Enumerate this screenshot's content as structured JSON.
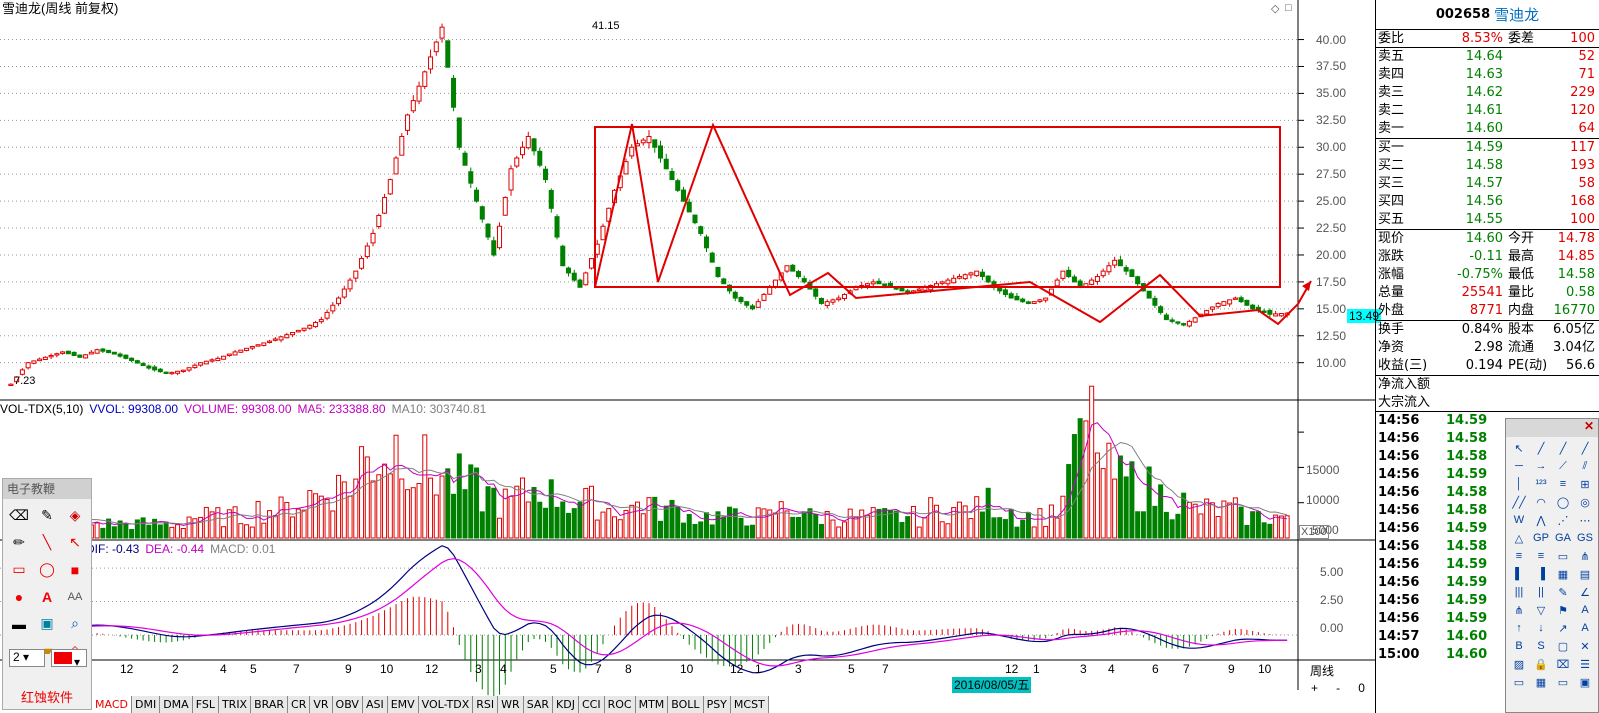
{
  "title": "雪迪龙(周线 前复权)",
  "window_controls": [
    "◇",
    "□"
  ],
  "price_axis": [
    "40.00",
    "37.50",
    "35.00",
    "32.50",
    "30.00",
    "27.50",
    "25.00",
    "22.50",
    "20.00",
    "17.50",
    "15.00",
    "12.50",
    "10.00"
  ],
  "high_label": "41.15",
  "low_label": "7.23",
  "current_price_box": "13.49",
  "vol_header": {
    "name": "VOL-TDX(5,10)",
    "vvol": "VVOL: 99308.00",
    "volume": "VOLUME: 99308.00",
    "ma5": "MA5: 233388.80",
    "ma10": "MA10: 303740.81"
  },
  "vol_axis": [
    "15000",
    "10000",
    "5000"
  ],
  "vol_unit": "X100",
  "macd_header": {
    "name": "MACD",
    "dif": "DIF: -0.43",
    "dea": "DEA: -0.44",
    "macd": "MACD: 0.01"
  },
  "macd_axis": [
    "5.00",
    "2.50",
    "0.00"
  ],
  "x_axis_labels": [
    "12",
    "2",
    "4",
    "5",
    "7",
    "9",
    "10",
    "12",
    "3",
    "4",
    "5",
    "7",
    "8",
    "10",
    "12",
    "1",
    "3",
    "5",
    "7",
    "2016/08/05/五",
    "12",
    "1",
    "3",
    "4",
    "6",
    "7",
    "9",
    "10"
  ],
  "period_label": "周线",
  "nav_controls": [
    "+",
    "-",
    "0"
  ],
  "tabs": [
    "MACD",
    "DMI",
    "DMA",
    "FSL",
    "TRIX",
    "BRAR",
    "CR",
    "VR",
    "OBV",
    "ASI",
    "EMV",
    "VOL-TDX",
    "RSI",
    "WR",
    "SAR",
    "KDJ",
    "CCI",
    "ROC",
    "MTM",
    "BOLL",
    "PSY",
    "MCST"
  ],
  "tools_window": {
    "title": "电子教鞭",
    "line_width": "2",
    "footer": "红蚀软件"
  },
  "quote": {
    "code": "002658",
    "name": "雪迪龙",
    "weibi_label": "委比",
    "weibi": "8.53%",
    "weicha_label": "委差",
    "weicha": "100",
    "sell": [
      [
        "卖五",
        "14.64",
        "52"
      ],
      [
        "卖四",
        "14.63",
        "71"
      ],
      [
        "卖三",
        "14.62",
        "229"
      ],
      [
        "卖二",
        "14.61",
        "120"
      ],
      [
        "卖一",
        "14.60",
        "64"
      ]
    ],
    "buy": [
      [
        "买一",
        "14.59",
        "117"
      ],
      [
        "买二",
        "14.58",
        "193"
      ],
      [
        "买三",
        "14.57",
        "58"
      ],
      [
        "买四",
        "14.56",
        "168"
      ],
      [
        "买五",
        "14.55",
        "100"
      ]
    ],
    "stats": [
      [
        "现价",
        "14.60",
        "今开",
        "14.78"
      ],
      [
        "涨跌",
        "-0.11",
        "最高",
        "14.85"
      ],
      [
        "涨幅",
        "-0.75%",
        "最低",
        "14.58"
      ],
      [
        "总量",
        "25541",
        "量比",
        "0.58"
      ],
      [
        "外盘",
        "8771",
        "内盘",
        "16770"
      ]
    ],
    "stats2": [
      [
        "换手",
        "0.84%",
        "股本",
        "6.05亿"
      ],
      [
        "净资",
        "2.98",
        "流通",
        "3.04亿"
      ],
      [
        "收益(三)",
        "0.194",
        "PE(动)",
        "56.6"
      ]
    ],
    "flow": [
      "净流入额",
      "大宗流入"
    ],
    "ticks": [
      [
        "14:56",
        "14.59"
      ],
      [
        "14:56",
        "14.58"
      ],
      [
        "14:56",
        "14.58"
      ],
      [
        "14:56",
        "14.59"
      ],
      [
        "14:56",
        "14.58"
      ],
      [
        "14:56",
        "14.58"
      ],
      [
        "14:56",
        "14.59"
      ],
      [
        "14:56",
        "14.58"
      ],
      [
        "14:56",
        "14.59"
      ],
      [
        "14:56",
        "14.59"
      ],
      [
        "14:56",
        "14.59"
      ],
      [
        "14:56",
        "14.59"
      ],
      [
        "14:57",
        "14.60"
      ],
      [
        "15:00",
        "14.60"
      ]
    ]
  },
  "chart_data": {
    "type": "candlestick",
    "title": "雪迪龙(周线 前复权)",
    "y_range": [
      7,
      42
    ],
    "price_path": [
      8,
      10,
      10.5,
      11,
      10.5,
      11.2,
      10.8,
      10.2,
      9.5,
      9.0,
      9.3,
      10,
      10.4,
      11,
      11.5,
      12,
      12.6,
      13.2,
      14,
      16,
      18.5,
      22,
      27,
      33,
      37,
      41.15,
      30,
      25,
      20,
      28,
      31,
      27,
      19,
      17,
      21,
      26,
      30,
      31,
      28,
      25,
      22,
      18,
      16,
      15,
      17,
      19,
      17.5,
      15.5,
      16,
      17,
      17.5,
      17,
      16.5,
      17,
      17.5,
      18,
      18.5,
      17,
      16,
      15.5,
      16,
      18.5,
      17,
      18,
      19.5,
      18,
      16,
      14,
      13.5,
      14.5,
      15.5,
      16,
      15,
      14.5,
      14.6
    ],
    "volume_path": [
      3,
      2,
      3,
      2,
      2,
      2,
      2,
      2,
      2,
      2,
      3,
      3,
      3,
      3,
      4,
      4,
      5,
      6,
      7,
      8,
      11,
      12,
      13,
      10,
      9,
      8,
      7,
      6,
      5,
      6,
      7,
      6,
      5,
      5,
      4,
      4,
      5,
      4,
      4,
      3,
      3,
      3,
      3,
      3,
      4,
      4,
      3,
      3,
      3,
      3,
      3,
      3,
      3,
      4,
      4,
      4,
      5,
      4,
      3,
      3,
      4,
      12,
      16,
      9,
      8,
      7,
      6,
      5,
      4,
      4,
      4,
      3,
      3,
      3
    ],
    "vol_range": [
      0,
      17000
    ],
    "macd_range": [
      -1.5,
      6.5
    ]
  }
}
